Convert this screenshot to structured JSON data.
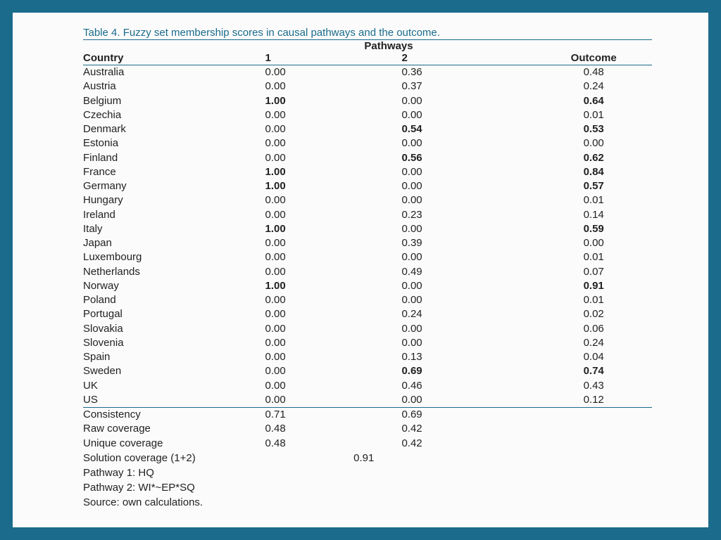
{
  "title": "Table 4. Fuzzy set membership scores in causal pathways and the outcome.",
  "group_header": "Pathways",
  "columns": {
    "country": "Country",
    "p1": "1",
    "p2": "2",
    "outcome": "Outcome"
  },
  "rows": [
    {
      "country": "Australia",
      "p1": "0.00",
      "p2": "0.36",
      "outcome": "0.48"
    },
    {
      "country": "Austria",
      "p1": "0.00",
      "p2": "0.37",
      "outcome": "0.24"
    },
    {
      "country": "Belgium",
      "p1": "1.00",
      "p1b": true,
      "p2": "0.00",
      "outcome": "0.64",
      "ob": true
    },
    {
      "country": "Czechia",
      "p1": "0.00",
      "p2": "0.00",
      "outcome": "0.01"
    },
    {
      "country": "Denmark",
      "p1": "0.00",
      "p2": "0.54",
      "p2b": true,
      "outcome": "0.53",
      "ob": true
    },
    {
      "country": "Estonia",
      "p1": "0.00",
      "p2": "0.00",
      "outcome": "0.00"
    },
    {
      "country": "Finland",
      "p1": "0.00",
      "p2": "0.56",
      "p2b": true,
      "outcome": "0.62",
      "ob": true
    },
    {
      "country": "France",
      "p1": "1.00",
      "p1b": true,
      "p2": "0.00",
      "outcome": "0.84",
      "ob": true
    },
    {
      "country": "Germany",
      "p1": "1.00",
      "p1b": true,
      "p2": "0.00",
      "outcome": "0.57",
      "ob": true
    },
    {
      "country": "Hungary",
      "p1": "0.00",
      "p2": "0.00",
      "outcome": "0.01"
    },
    {
      "country": "Ireland",
      "p1": "0.00",
      "p2": "0.23",
      "outcome": "0.14"
    },
    {
      "country": "Italy",
      "p1": "1.00",
      "p1b": true,
      "p2": "0.00",
      "outcome": "0.59",
      "ob": true
    },
    {
      "country": "Japan",
      "p1": "0.00",
      "p2": "0.39",
      "outcome": "0.00"
    },
    {
      "country": "Luxembourg",
      "p1": "0.00",
      "p2": "0.00",
      "outcome": "0.01"
    },
    {
      "country": "Netherlands",
      "p1": "0.00",
      "p2": "0.49",
      "outcome": "0.07"
    },
    {
      "country": "Norway",
      "p1": "1.00",
      "p1b": true,
      "p2": "0.00",
      "outcome": "0.91",
      "ob": true
    },
    {
      "country": "Poland",
      "p1": "0.00",
      "p2": "0.00",
      "outcome": "0.01"
    },
    {
      "country": "Portugal",
      "p1": "0.00",
      "p2": "0.24",
      "outcome": "0.02"
    },
    {
      "country": "Slovakia",
      "p1": "0.00",
      "p2": "0.00",
      "outcome": "0.06"
    },
    {
      "country": "Slovenia",
      "p1": "0.00",
      "p2": "0.00",
      "outcome": "0.24"
    },
    {
      "country": "Spain",
      "p1": "0.00",
      "p2": "0.13",
      "outcome": "0.04"
    },
    {
      "country": "Sweden",
      "p1": "0.00",
      "p2": "0.69",
      "p2b": true,
      "outcome": "0.74",
      "ob": true
    },
    {
      "country": "UK",
      "p1": "0.00",
      "p2": "0.46",
      "outcome": "0.43"
    },
    {
      "country": "US",
      "p1": "0.00",
      "p2": "0.00",
      "outcome": "0.12"
    }
  ],
  "summary": [
    {
      "label": "Consistency",
      "p1": "0.71",
      "p2": "0.69"
    },
    {
      "label": "Raw coverage",
      "p1": "0.48",
      "p2": "0.42"
    },
    {
      "label": "Unique coverage",
      "p1": "0.48",
      "p2": "0.42"
    }
  ],
  "solution": {
    "label": "Solution coverage (1+2)",
    "value": "0.91"
  },
  "footer": [
    "Pathway 1: HQ",
    "Pathway 2: WI*~EP*SQ",
    "Source: own calculations."
  ],
  "chart_data": {
    "type": "table",
    "title": "Fuzzy set membership scores in causal pathways and the outcome",
    "columns": [
      "Country",
      "Pathway 1",
      "Pathway 2",
      "Outcome"
    ],
    "rows": [
      [
        "Australia",
        0.0,
        0.36,
        0.48
      ],
      [
        "Austria",
        0.0,
        0.37,
        0.24
      ],
      [
        "Belgium",
        1.0,
        0.0,
        0.64
      ],
      [
        "Czechia",
        0.0,
        0.0,
        0.01
      ],
      [
        "Denmark",
        0.0,
        0.54,
        0.53
      ],
      [
        "Estonia",
        0.0,
        0.0,
        0.0
      ],
      [
        "Finland",
        0.0,
        0.56,
        0.62
      ],
      [
        "France",
        1.0,
        0.0,
        0.84
      ],
      [
        "Germany",
        1.0,
        0.0,
        0.57
      ],
      [
        "Hungary",
        0.0,
        0.0,
        0.01
      ],
      [
        "Ireland",
        0.0,
        0.23,
        0.14
      ],
      [
        "Italy",
        1.0,
        0.0,
        0.59
      ],
      [
        "Japan",
        0.0,
        0.39,
        0.0
      ],
      [
        "Luxembourg",
        0.0,
        0.0,
        0.01
      ],
      [
        "Netherlands",
        0.0,
        0.49,
        0.07
      ],
      [
        "Norway",
        1.0,
        0.0,
        0.91
      ],
      [
        "Poland",
        0.0,
        0.0,
        0.01
      ],
      [
        "Portugal",
        0.0,
        0.24,
        0.02
      ],
      [
        "Slovakia",
        0.0,
        0.0,
        0.06
      ],
      [
        "Slovenia",
        0.0,
        0.0,
        0.24
      ],
      [
        "Spain",
        0.0,
        0.13,
        0.04
      ],
      [
        "Sweden",
        0.0,
        0.69,
        0.74
      ],
      [
        "UK",
        0.0,
        0.46,
        0.43
      ],
      [
        "US",
        0.0,
        0.0,
        0.12
      ]
    ],
    "summary": {
      "Consistency": [
        0.71,
        0.69
      ],
      "Raw coverage": [
        0.48,
        0.42
      ],
      "Unique coverage": [
        0.48,
        0.42
      ],
      "Solution coverage (1+2)": 0.91
    }
  }
}
